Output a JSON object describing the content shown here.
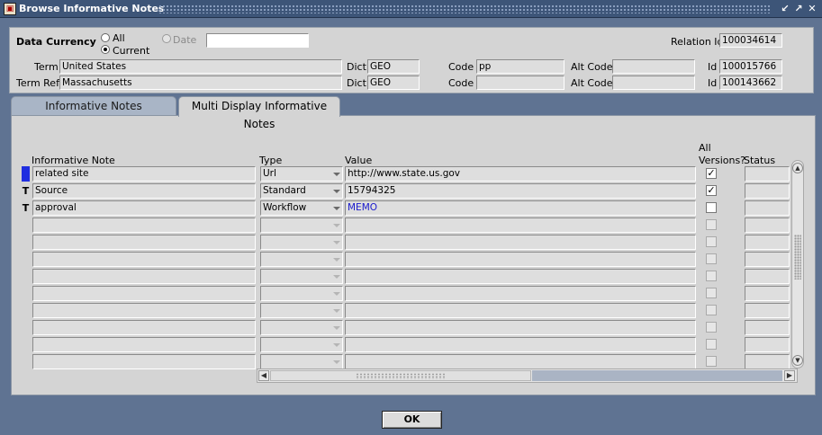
{
  "window": {
    "title": "Browse Informative Notes",
    "controls": {
      "minimize": "↙",
      "maximize": "↗",
      "close": "✕"
    }
  },
  "header": {
    "data_currency_label": "Data Currency",
    "radio_all": "All",
    "radio_current": "Current",
    "radio_date": "Date",
    "date_value": "",
    "relation_id_label": "Relation Id",
    "relation_id_value": "100034614",
    "term_label": "Term",
    "term_value": "United States",
    "term_dict_label": "Dict",
    "term_dict_value": "GEO",
    "term_code_label": "Code",
    "term_code_value": "pp",
    "term_altcode_label": "Alt Code",
    "term_altcode_value": "",
    "term_id_label": "Id",
    "term_id_value": "100015766",
    "termref_label": "Term Ref",
    "termref_value": "Massachusetts",
    "termref_dict_label": "Dict",
    "termref_dict_value": "GEO",
    "termref_code_label": "Code",
    "termref_code_value": "",
    "termref_altcode_label": "Alt Code",
    "termref_altcode_value": "",
    "termref_id_label": "Id",
    "termref_id_value": "100143662"
  },
  "tabs": [
    {
      "label": "Informative Notes",
      "active": false
    },
    {
      "label": "Multi Display Informative Notes",
      "active": true
    }
  ],
  "grid": {
    "columns": {
      "note": "Informative Note",
      "type": "Type",
      "value": "Value",
      "all_versions_line1": "All",
      "all_versions_line2": "Versions?",
      "status": "Status"
    },
    "rows": [
      {
        "indicator": "",
        "note": "related site",
        "type": "Url",
        "value": "http://www.state.us.gov",
        "all_versions": true,
        "status": "",
        "current": true
      },
      {
        "indicator": "T",
        "note": "Source",
        "type": "Standard",
        "value": "15794325",
        "all_versions": true,
        "status": ""
      },
      {
        "indicator": "T",
        "note": "approval",
        "type": "Workflow",
        "value": "MEMO",
        "all_versions": false,
        "status": "",
        "value_color": "#1a1acc"
      }
    ],
    "empty_row_count": 9
  },
  "colors": {
    "background": "#5f7392",
    "title_bar": "#3d5578",
    "panel": "#d4d4d4",
    "current_row_indicator": "#1f2ee0",
    "link_value": "#1a1acc"
  },
  "ok_button_label": "OK"
}
